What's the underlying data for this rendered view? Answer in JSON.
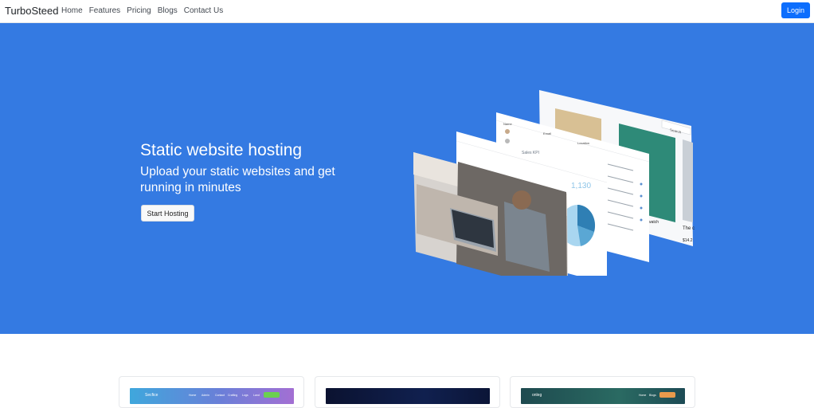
{
  "navbar": {
    "brand": "TurboSteed",
    "links": [
      "Home",
      "Features",
      "Pricing",
      "Blogs",
      "Contact Us"
    ],
    "login_label": "Login"
  },
  "hero": {
    "title": "Static website hosting",
    "subtitle": "Upload your static websites and get running in minutes",
    "cta_label": "Start Hosting",
    "bg_color": "#347ae2"
  },
  "mockup": {
    "dashboard_title": "Sales KPI",
    "kpi_value": "1,130",
    "search_label": "Search",
    "product_title": "The c",
    "product_price": "$14.2",
    "product_caption": "watch",
    "table_header": "Name",
    "table_col_email": "Email",
    "table_col_location": "Location"
  },
  "cards": [
    {
      "logo": "Secfice",
      "nav": [
        "Home",
        "Admin",
        "Contact",
        "Crafting",
        "Logs",
        "Land"
      ],
      "pill": "Join",
      "pill_color": "#6bd04f"
    },
    {
      "logo": "",
      "nav": [],
      "pill": "",
      "pill_color": ""
    },
    {
      "logo": "onleg",
      "nav": [
        "Home",
        "Blogs"
      ],
      "pill": "Join",
      "pill_color": "#e99a4c"
    }
  ]
}
